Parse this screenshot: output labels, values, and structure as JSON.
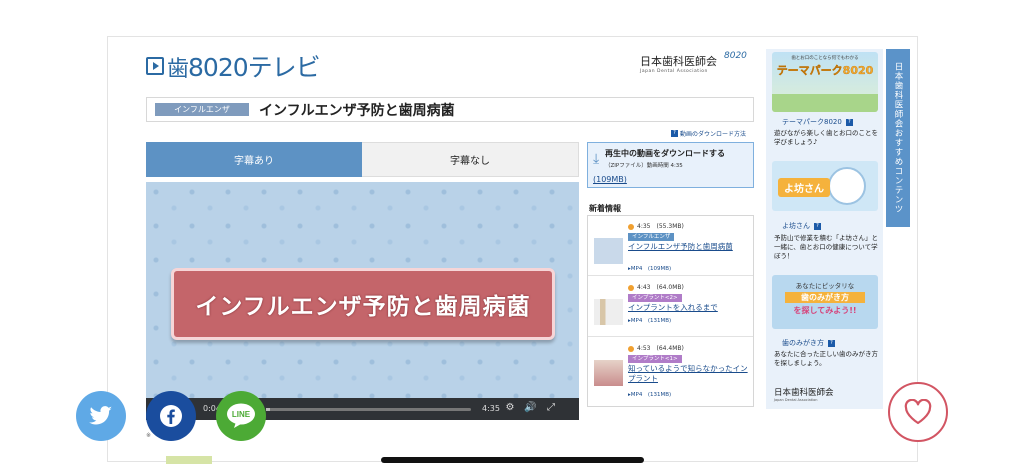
{
  "header": {
    "logo_text": "8020テレビ",
    "org_name": "日本歯科医師会",
    "org_en": "Japan Dental Association",
    "org_mark": "8020"
  },
  "video": {
    "category": "インフルエンザ",
    "title": "インフルエンザ予防と歯周病菌",
    "download_help": "動画のダウンロード方法",
    "tabs": [
      {
        "label": "字幕あり",
        "active": true
      },
      {
        "label": "字幕なし",
        "active": false
      }
    ],
    "banner_text": "インフルエンザ予防と歯周病菌",
    "current_time": "0:04",
    "duration": "4:35",
    "progress": 0.02,
    "note": "※"
  },
  "download": {
    "title": "再生中の動画をダウンロードする",
    "sub": "（ZIPファイル）動画時間 4:35",
    "size": "(109MB)"
  },
  "news": {
    "heading": "新着情報",
    "items": [
      {
        "time": "4:35",
        "size": "(55.3MB)",
        "tag": "インフルエンザ",
        "tag_color": "#5d92c4",
        "title": "インフルエンザ予防と歯周病菌",
        "format": "MP4",
        "format_size": "(109MB)"
      },
      {
        "time": "4:43",
        "size": "(64.0MB)",
        "tag": "インプラント<2>",
        "tag_color": "#b07cc8",
        "title": "インプラントを入れるまで",
        "format": "MP4",
        "format_size": "(131MB)"
      },
      {
        "time": "4:53",
        "size": "(64.4MB)",
        "tag": "インプラント<1>",
        "tag_color": "#b07cc8",
        "title": "知っているようで知らなかったインプラント",
        "format": "MP4",
        "format_size": "(131MB)"
      }
    ]
  },
  "sidebar": {
    "rail_label": "日本歯科医師会おすすめコンテンツ",
    "banner1_top": "歯とお口のことなら何でもわかる",
    "banner1_title": "テーマパーク8020",
    "link1": "テーマパーク8020",
    "desc1": "遊びながら楽しく歯とお口のことを学びましょう♪",
    "banner2_title": "よ坊さん",
    "link2": "よ坊さん",
    "desc2": "予防山で修業を積む「よ坊さん」と一緒に、歯とお口の健康について学ぼう！",
    "banner3_line1": "あなたにピッタリな",
    "banner3_line2": "歯のみがき方",
    "banner3_line3": "を探してみよう!!",
    "link3": "歯のみがき方",
    "desc3": "あなたに合った正しい歯のみがき方を探しましょう。",
    "logo_name": "日本歯科医師会",
    "logo_en": "Japan Dental Association"
  },
  "share": {
    "twitter_icon": "twitter-bird-icon",
    "facebook_icon": "facebook-f-icon",
    "line_label": "LINE",
    "favorite_icon": "heart-icon"
  }
}
